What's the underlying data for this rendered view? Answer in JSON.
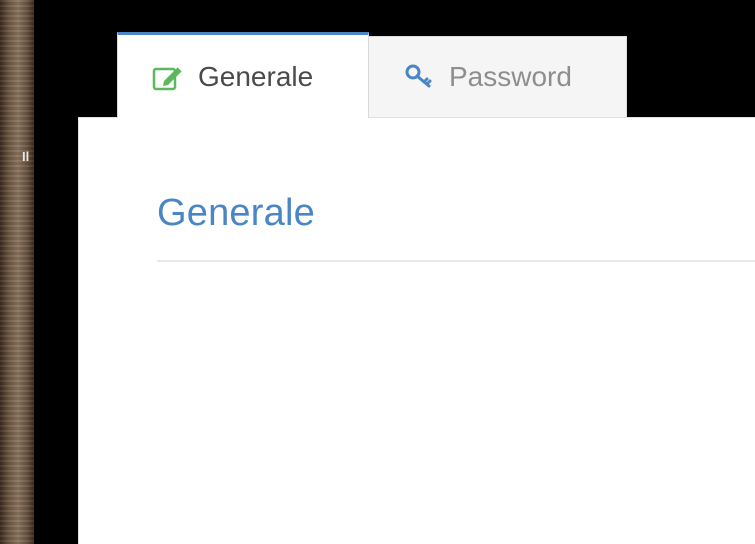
{
  "tabs": [
    {
      "label": "Generale",
      "icon": "edit-icon",
      "active": true
    },
    {
      "label": "Password",
      "icon": "key-icon",
      "active": false
    }
  ],
  "section": {
    "title": "Generale"
  },
  "colors": {
    "accent": "#4a86c5",
    "edit_icon": "#5cb85c",
    "key_icon": "#4a86c5"
  }
}
